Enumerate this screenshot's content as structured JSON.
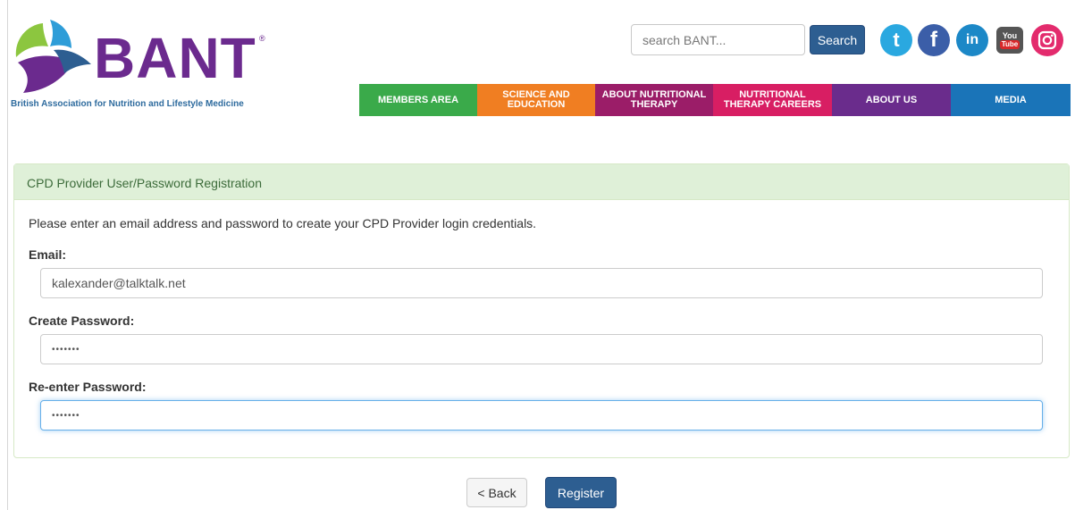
{
  "header": {
    "logo_word": "BANT",
    "logo_reg": "®",
    "logo_tagline": "British Association for Nutrition and Lifestyle Medicine",
    "search": {
      "placeholder": "search BANT...",
      "button_label": "Search"
    },
    "social": [
      {
        "name": "twitter-icon",
        "glyph": "t"
      },
      {
        "name": "facebook-icon",
        "glyph": "f"
      },
      {
        "name": "linkedin-icon",
        "glyph": "in"
      },
      {
        "name": "youtube-icon",
        "glyph_top": "You",
        "glyph_bottom": "Tube"
      },
      {
        "name": "instagram-icon"
      }
    ]
  },
  "nav": {
    "items": [
      {
        "label": "MEMBERS AREA",
        "color": "#3aaa4a"
      },
      {
        "label": "SCIENCE AND EDUCATION",
        "color": "#f07e22"
      },
      {
        "label": "ABOUT NUTRITIONAL THERAPY",
        "color": "#9b1d68"
      },
      {
        "label": "NUTRITIONAL THERAPY CAREERS",
        "color": "#d81e63"
      },
      {
        "label": "ABOUT US",
        "color": "#6a2c8c"
      },
      {
        "label": "MEDIA",
        "color": "#1a74b8"
      }
    ]
  },
  "form": {
    "title": "CPD Provider User/Password Registration",
    "intro": "Please enter an email address and password to create your CPD Provider login credentials.",
    "email": {
      "label": "Email:",
      "value": "kalexander@talktalk.net"
    },
    "password": {
      "label": "Create Password:",
      "value": "•••••••"
    },
    "confirm": {
      "label": "Re-enter Password:",
      "value": "•••••••"
    },
    "back_label": "< Back",
    "register_label": "Register"
  },
  "colors": {
    "brand_purple": "#6b2a8e",
    "button_blue": "#2d5e91",
    "panel_green": "#dff0d8"
  }
}
